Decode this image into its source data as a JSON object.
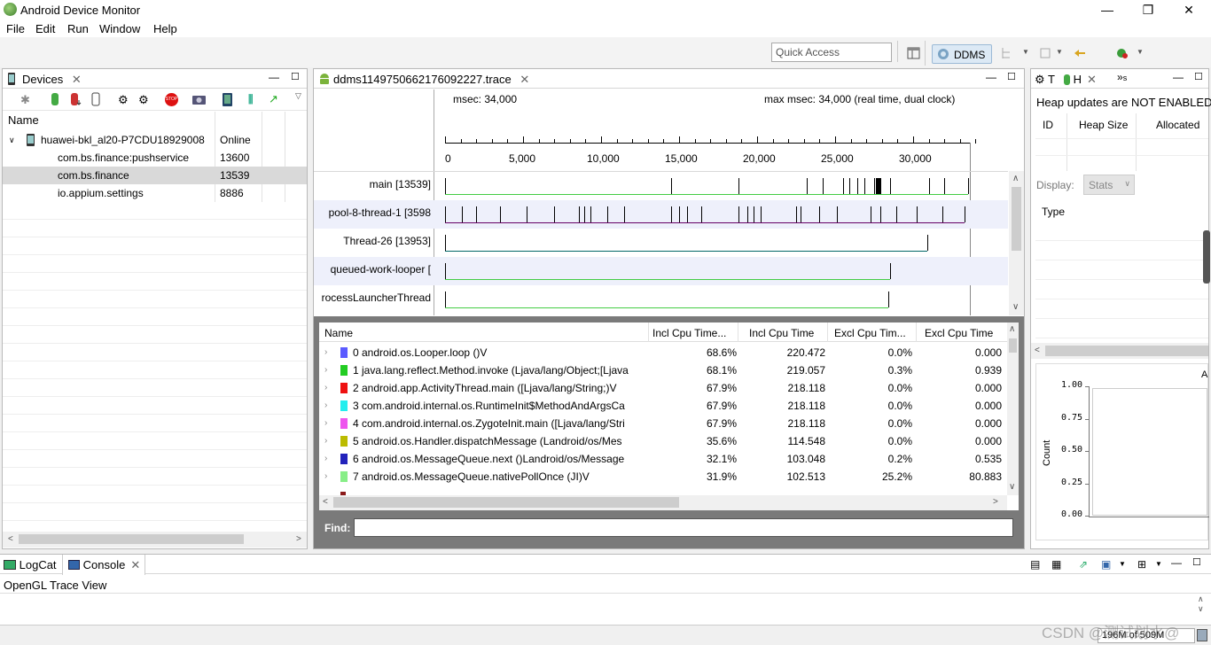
{
  "app": {
    "title": "Android Device Monitor"
  },
  "window_controls": {
    "minimize": "—",
    "maximize": "❐",
    "close": "✕"
  },
  "menu": [
    "File",
    "Edit",
    "Run",
    "Window",
    "Help"
  ],
  "toolbar": {
    "quick_access_placeholder": "Quick Access",
    "perspective": "DDMS"
  },
  "devices": {
    "tab": "Devices",
    "column_name": "Name",
    "device": {
      "name": "huawei-bkl_al20-P7CDU18929008",
      "status": "Online"
    },
    "processes": [
      {
        "name": "com.bs.finance:pushservice",
        "pid": "13600"
      },
      {
        "name": "com.bs.finance",
        "pid": "13539"
      },
      {
        "name": "io.appium.settings",
        "pid": "8886"
      }
    ]
  },
  "trace": {
    "tab": "ddms1149750662176092227.trace",
    "msec_label": "msec: 34,000",
    "max_msec_label": "max msec: 34,000 (real time, dual clock)",
    "ticks": [
      "0",
      "5,000",
      "10,000",
      "15,000",
      "20,000",
      "25,000",
      "30,000"
    ],
    "threads": [
      "[13539] main",
      "3598] pool-8-thread-1",
      "[13953] Thread-26",
      "] queued-work-looper",
      "rocessLauncherThread"
    ],
    "columns": [
      "Name",
      "Incl Cpu Time...",
      "Incl Cpu Time",
      "Excl Cpu Tim...",
      "Excl Cpu Time"
    ],
    "rows": [
      {
        "color": "#5b5bff",
        "name": "0 android.os.Looper.loop ()V",
        "incl_pct": "68.6%",
        "incl": "220.472",
        "excl_pct": "0.0%",
        "excl": "0.000"
      },
      {
        "color": "#22cc22",
        "name": "1 java.lang.reflect.Method.invoke (Ljava/lang/Object;[Ljava",
        "incl_pct": "68.1%",
        "incl": "219.057",
        "excl_pct": "0.3%",
        "excl": "0.939"
      },
      {
        "color": "#ee1111",
        "name": "2 android.app.ActivityThread.main ([Ljava/lang/String;)V",
        "incl_pct": "67.9%",
        "incl": "218.118",
        "excl_pct": "0.0%",
        "excl": "0.000"
      },
      {
        "color": "#22eeee",
        "name": "3 com.android.internal.os.RuntimeInit$MethodAndArgsCa",
        "incl_pct": "67.9%",
        "incl": "218.118",
        "excl_pct": "0.0%",
        "excl": "0.000"
      },
      {
        "color": "#ee55ee",
        "name": "4 com.android.internal.os.ZygoteInit.main ([Ljava/lang/Stri",
        "incl_pct": "67.9%",
        "incl": "218.118",
        "excl_pct": "0.0%",
        "excl": "0.000"
      },
      {
        "color": "#bbbb00",
        "name": "5 android.os.Handler.dispatchMessage (Landroid/os/Mes",
        "incl_pct": "35.6%",
        "incl": "114.548",
        "excl_pct": "0.0%",
        "excl": "0.000"
      },
      {
        "color": "#2222bb",
        "name": "6 android.os.MessageQueue.next ()Landroid/os/Message",
        "incl_pct": "32.1%",
        "incl": "103.048",
        "excl_pct": "0.2%",
        "excl": "0.535"
      },
      {
        "color": "#88ee88",
        "name": "7 android.os.MessageQueue.nativePollOnce (JI)V",
        "incl_pct": "31.9%",
        "incl": "102.513",
        "excl_pct": "25.2%",
        "excl": "80.883"
      }
    ],
    "find_label": "Find:"
  },
  "heap": {
    "tab_t": "T",
    "tab_h": "H",
    "tab_s": "s",
    "message": "Heap updates are NOT ENABLED",
    "columns": [
      "ID",
      "Heap Size",
      "Allocated"
    ],
    "display_label": "Display:",
    "display_value": "Stats",
    "type_label": "Type",
    "chart_ylabel": "Count",
    "chart_ticks": [
      "1.00",
      "0.75",
      "0.50",
      "0.25",
      "0.00"
    ],
    "chart_corner": "A"
  },
  "bottom": {
    "tab_logcat": "LogCat",
    "tab_console": "Console",
    "console_text": "OpenGL Trace View",
    "memory": "196M of 509M"
  },
  "watermark": "CSDN @测试划水@"
}
